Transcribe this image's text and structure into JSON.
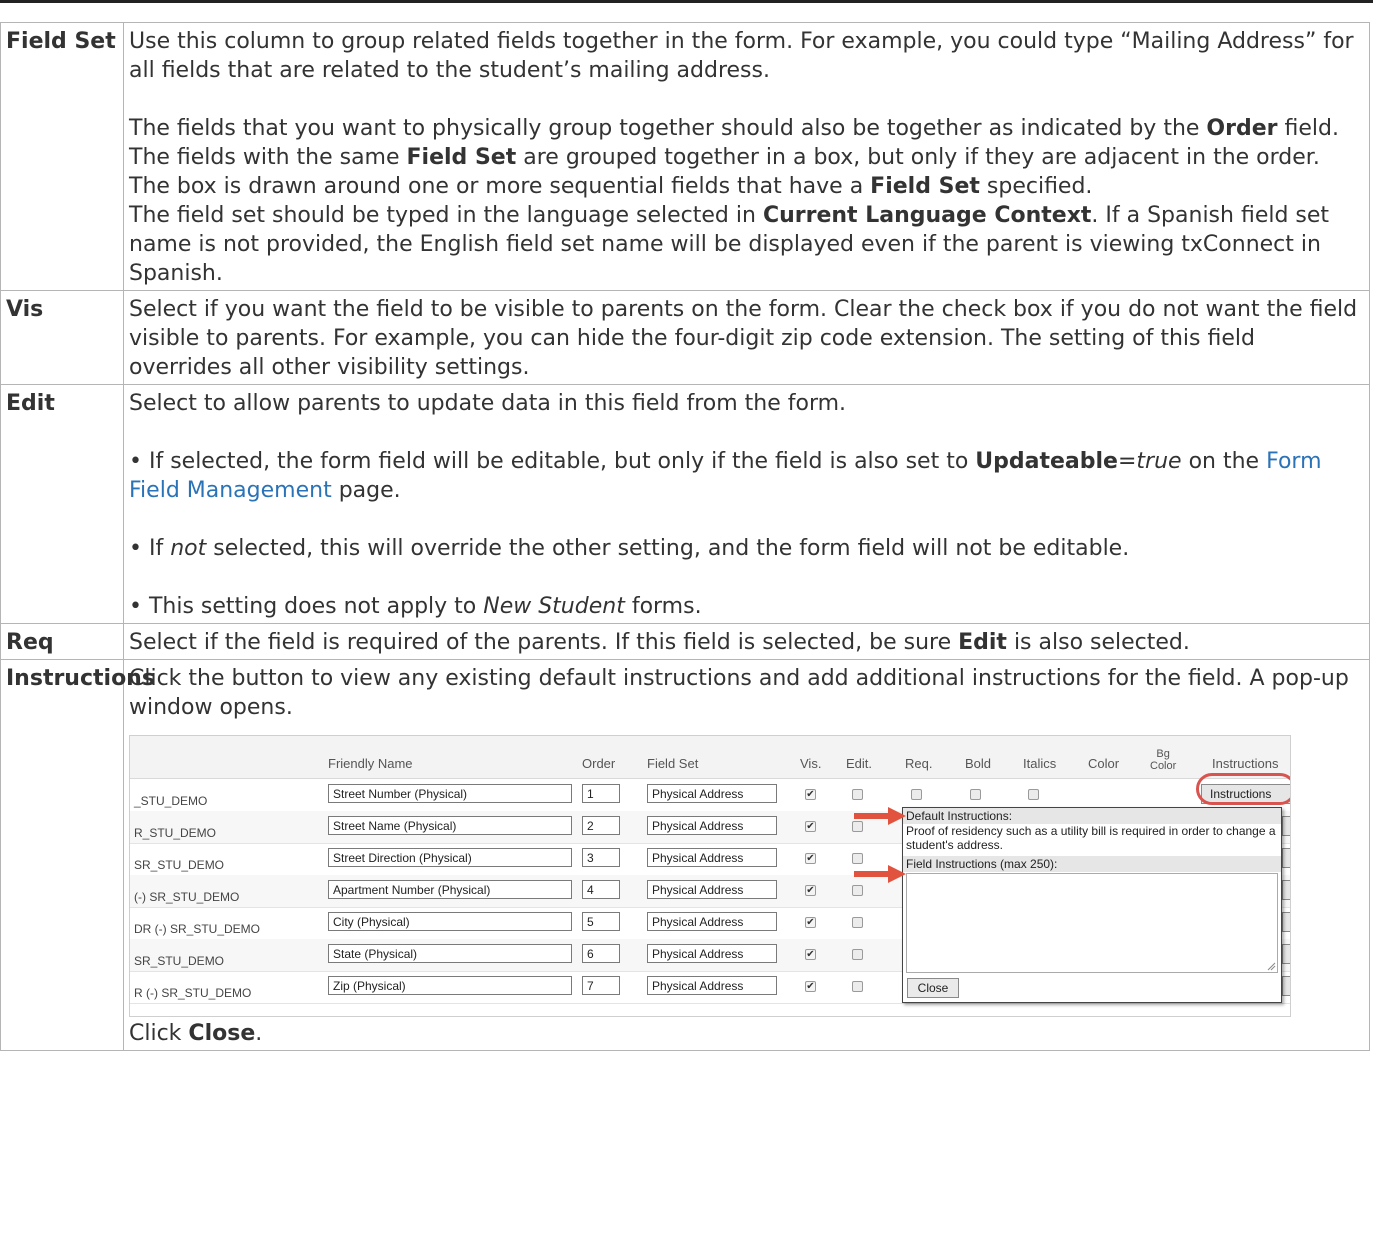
{
  "rows": [
    {
      "term": "Field Set",
      "p1": "Use this column to group related fields together in the form. For example, you could type “Mailing Address” for all fields that are related to the student’s mailing address.",
      "p2_a": "The fields that you want to physically group together should also be together as indicated by the ",
      "p2_b1": "Order",
      "p2_c": " field. The fields with the same ",
      "p2_b2": "Field Set",
      "p2_d": " are grouped together in a box, but only if they are adjacent in the order. The box is drawn around one or more sequential fields that have a ",
      "p2_b3": "Field Set",
      "p2_e": " specified.",
      "p3_a": "The field set should be typed in the language selected in ",
      "p3_b": "Current Language Context",
      "p3_c": ". If a Spanish field set name is not provided, the English field set name will be displayed even if the parent is viewing txConnect in Spanish."
    },
    {
      "term": "Vis",
      "p1": "Select if you want the field to be visible to parents on the form. Clear the check box if you do not want the field visible to parents. For example, you can hide the four-digit zip code extension. The setting of this field overrides all other visibility settings."
    },
    {
      "term": "Edit",
      "p1": "Select to allow parents to update data in this field from the form.",
      "b1_a": "• If selected, the form field will be editable, but only if the field is also set to ",
      "b1_b": "Updateable",
      "b1_c": "=",
      "b1_d": "true",
      "b1_e": " on the ",
      "b1_link": "Form Field Management",
      "b1_f": " page.",
      "b2_a": "• If ",
      "b2_b": "not",
      "b2_c": " selected, this will override the other setting, and the form field will not be editable.",
      "b3_a": "• This setting does not apply to ",
      "b3_b": "New Student",
      "b3_c": " forms."
    },
    {
      "term": "Req",
      "p1_a": "Select if the field is required of the parents. If this field is selected, be sure ",
      "p1_b": "Edit",
      "p1_c": " is also selected."
    },
    {
      "term": "Instructions",
      "p1": "Click the button to view any existing default instructions and add additional instructions for the field. A pop-up window opens.",
      "close_a": "Click ",
      "close_b": "Close",
      "close_c": "."
    }
  ],
  "screenshot": {
    "headers": {
      "friendly_name": "Friendly Name",
      "order": "Order",
      "field_set": "Field Set",
      "vis": "Vis.",
      "edit": "Edit.",
      "req": "Req.",
      "bold": "Bold",
      "italics": "Italics",
      "color": "Color",
      "bg_color_1": "Bg",
      "bg_color_2": "Color",
      "instructions": "Instructions"
    },
    "table_rows": [
      {
        "code": "_STU_DEMO",
        "friendly": "Street Number (Physical)",
        "order": "1",
        "field_set": "Physical Address"
      },
      {
        "code": "R_STU_DEMO",
        "friendly": "Street Name (Physical)",
        "order": "2",
        "field_set": "Physical Address"
      },
      {
        "code": "SR_STU_DEMO",
        "friendly": "Street Direction (Physical)",
        "order": "3",
        "field_set": "Physical Address"
      },
      {
        "code": "(-) SR_STU_DEMO",
        "friendly": "Apartment Number (Physical)",
        "order": "4",
        "field_set": "Physical Address"
      },
      {
        "code": "DR (-) SR_STU_DEMO",
        "friendly": "City (Physical)",
        "order": "5",
        "field_set": "Physical Address"
      },
      {
        "code": "SR_STU_DEMO",
        "friendly": "State (Physical)",
        "order": "6",
        "field_set": "Physical Address"
      },
      {
        "code": "R (-) SR_STU_DEMO",
        "friendly": "Zip (Physical)",
        "order": "7",
        "field_set": "Physical Address"
      }
    ],
    "instructions_button": "Instructions",
    "popup": {
      "default_label": "Default Instructions:",
      "default_text": "Proof of residency such as a utility bill is required in order to change a student's address.",
      "field_label": "Field Instructions (max 250):",
      "close": "Close"
    },
    "colors": {
      "arrow": "#e2533f",
      "oval": "#d9534f",
      "link": "#2b73b7"
    }
  }
}
